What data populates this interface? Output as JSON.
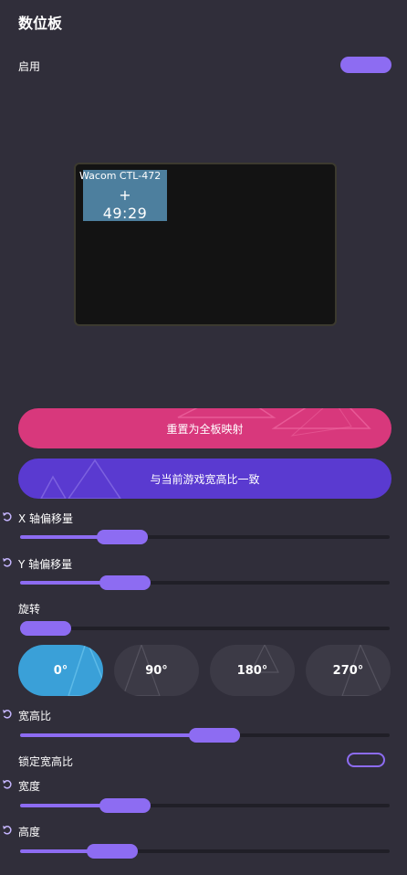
{
  "header": {
    "title": "数位板"
  },
  "enable": {
    "label": "启用",
    "state": "on"
  },
  "tablet_preview": {
    "device_name": "Wacom CTL-472",
    "center_marker": "+",
    "aspect_ratio": "49:29"
  },
  "buttons": {
    "reset_full": "重置为全板映射",
    "match_game": "与当前游戏宽高比一致"
  },
  "sliders": {
    "x_offset": {
      "label": "X 轴偏移量",
      "fraction": 0.24
    },
    "y_offset": {
      "label": "Y 轴偏移量",
      "fraction": 0.25
    },
    "rotation": {
      "label": "旋转",
      "fraction": 0.0
    },
    "aspect": {
      "label": "宽高比",
      "fraction": 0.53
    },
    "width": {
      "label": "宽度",
      "fraction": 0.25
    },
    "height": {
      "label": "高度",
      "fraction": 0.21
    }
  },
  "rotation_presets": [
    "0°",
    "90°",
    "180°",
    "270°"
  ],
  "rotation_selected": "0°",
  "lock_aspect": {
    "label": "锁定宽高比",
    "state": "off"
  },
  "colors": {
    "background": "#302e3a",
    "accent": "#8d6cf2",
    "pink": "#d8387c",
    "purple": "#5a3ad0",
    "blue": "#3aa0d8"
  }
}
